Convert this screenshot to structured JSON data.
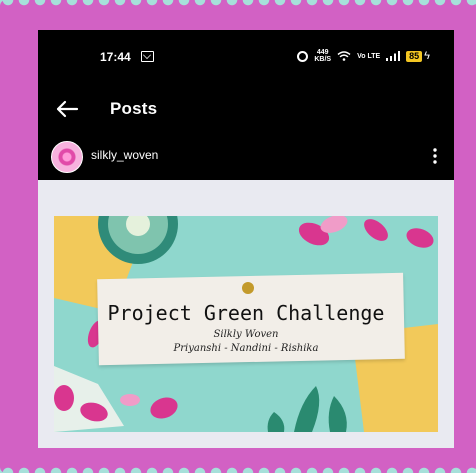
{
  "colors": {
    "frame": "#d261c4",
    "background": "#a6e0da",
    "topbar": "#000000",
    "battery": "#f3c623",
    "post_bg": "#8fd7cd"
  },
  "status_bar": {
    "time": "17:44",
    "net_speed_value": "449",
    "net_speed_unit": "KB/S",
    "volte": "Vo LTE",
    "battery": "85"
  },
  "header": {
    "title": "Posts",
    "back_icon": "arrow-left-icon"
  },
  "account": {
    "username": "silkly_woven",
    "more_icon": "more-vertical-icon"
  },
  "post": {
    "title": "Project Green Challenge",
    "subtitle": "Silkly Woven",
    "names": "Priyanshi - Nandini - Rishika"
  }
}
